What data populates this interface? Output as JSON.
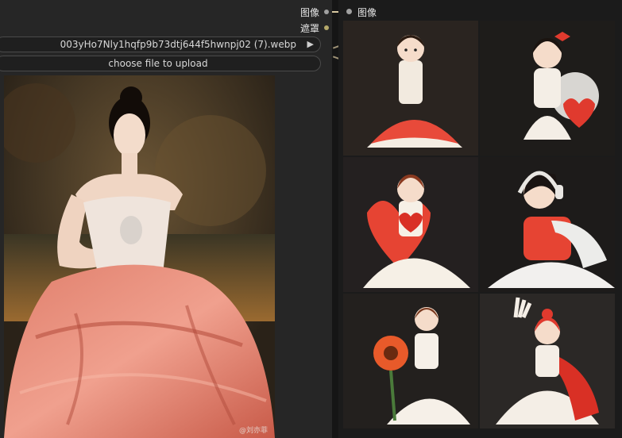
{
  "left_node": {
    "output_image_label": "图像",
    "output_mask_label": "遮罩",
    "image_file": "003yHo7Nly1hqfp9b73dtj644f5hwnpj02 (7).webp",
    "upload_label": "choose file to upload",
    "watermark": "@刘亦菲"
  },
  "right_node": {
    "input_image_label": "图像"
  },
  "colors": {
    "node_bg": "#262626",
    "canvas_bg": "#151515",
    "image_slot": "#a0a0a0",
    "mask_slot": "#b5a96a"
  }
}
